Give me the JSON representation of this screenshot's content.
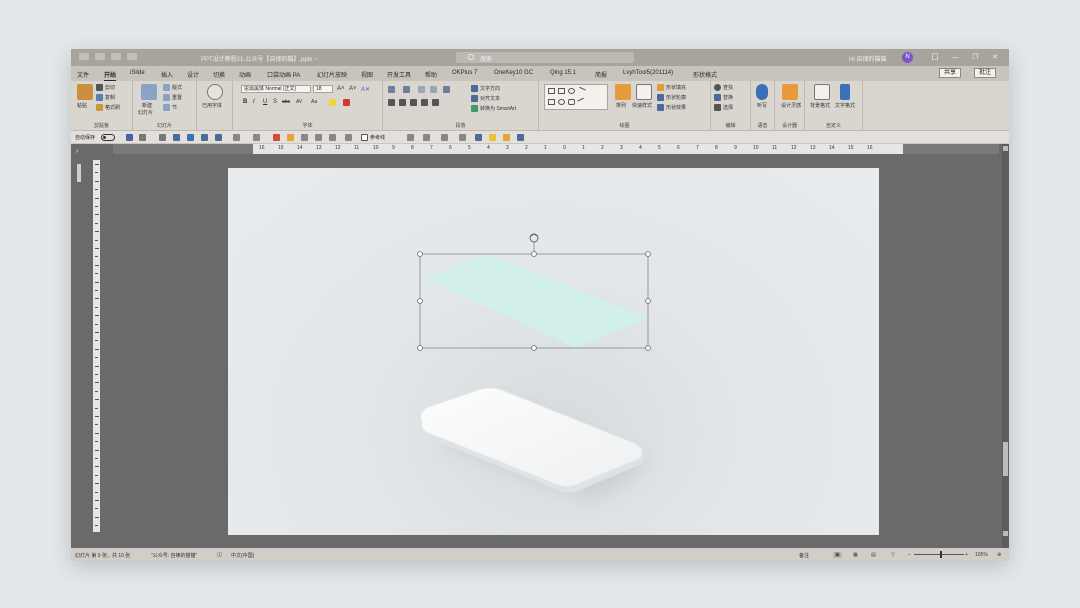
{
  "titlebar": {
    "doc_title": "PPT设计教程21-公众号【自律的猫】.pptx  ~",
    "search_placeholder": "搜索",
    "user_name": "Hi 自律的猫猫",
    "avatar_initial": "N",
    "controls": [
      "囗",
      "—",
      "❐",
      "✕"
    ]
  },
  "tabs": [
    "文件",
    "开始",
    "iSlide",
    "插入",
    "设计",
    "切换",
    "动画",
    "口袋动画 PA",
    "幻灯片放映",
    "视图",
    "开发工具",
    "帮助",
    "OKPlus 7",
    "OneKey10 GC",
    "Qing 15.1",
    "简报",
    "LvyhTool5(201114)",
    "形状格式"
  ],
  "active_tab": "开始",
  "share_label": "共享",
  "comment_label": "批注",
  "ribbon": {
    "clipboard": {
      "paste": "粘贴",
      "cut": "剪切",
      "copy": "复制",
      "format_painter": "格式刷",
      "label": "剪贴板"
    },
    "slides": {
      "new_slide": "新建",
      "new_slide_2": "幻灯片",
      "layout": "版式",
      "reset": "重置",
      "section": "节",
      "label": "幻灯片"
    },
    "font": {
      "font_name": "思源黑体 Normal (正文)",
      "font_size": "18",
      "bold": "B",
      "italic": "I",
      "underline": "U",
      "strike": "S",
      "label": "字体",
      "text_shadow": "abc",
      "char_spacing": "AV",
      "change_case": "Aa"
    },
    "paragraph": {
      "text_direction": "文字方向",
      "align_text": "对齐文本",
      "smartart": "转换为 SmartArt",
      "label": "段落"
    },
    "drawing": {
      "arrange": "排列",
      "quick_styles": "快速样式",
      "shape_fill": "形状填充",
      "shape_outline": "形状轮廓",
      "shape_effects": "形状效果",
      "label": "绘图"
    },
    "editing": {
      "find": "查找",
      "replace": "替换",
      "select": "选择",
      "label": "编辑"
    },
    "voice": {
      "dictate": "听写",
      "label": "语音"
    },
    "designer": {
      "design_ideas": "设计灵感",
      "label": "设计器"
    },
    "custom": {
      "bg_format": "背景格式",
      "text_format": "文字格式",
      "label": "自定义"
    },
    "uses_font": "已用字体"
  },
  "qat": {
    "autosave": "自动保存",
    "autosave_state": "关",
    "compare": "参考线"
  },
  "ruler_numbers": [
    "16",
    "15",
    "14",
    "13",
    "12",
    "11",
    "10",
    "9",
    "8",
    "7",
    "6",
    "5",
    "4",
    "3",
    "2",
    "1",
    "0",
    "1",
    "2",
    "3",
    "4",
    "5",
    "6",
    "7",
    "8",
    "9",
    "10",
    "11",
    "12",
    "13",
    "14",
    "15",
    "16"
  ],
  "statusbar": {
    "slide_info": "幻灯片 第 9 张，共 10 张",
    "theme": "\"公众号: 自律的猫猫\"",
    "language": "中文(中国)",
    "notes": "备注",
    "zoom": "105%"
  },
  "colors": {
    "accent_purple": "#7b55c8",
    "selection_fill": "#d2efe9",
    "titlebar_bg": "#a8a39c",
    "ribbon_bg": "#d9d5cf"
  }
}
